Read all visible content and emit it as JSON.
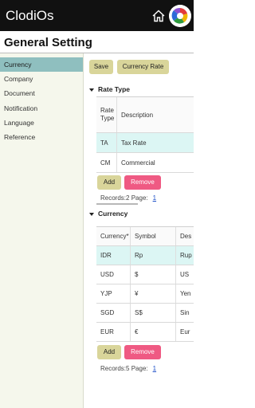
{
  "app": {
    "title": "ClodiOs"
  },
  "icons": {
    "home": "home-icon",
    "avatar": "avatar-icon"
  },
  "page": {
    "title": "General Setting"
  },
  "sidebar": {
    "items": [
      {
        "label": "Currency",
        "active": true
      },
      {
        "label": "Company"
      },
      {
        "label": "Document"
      },
      {
        "label": "Notification"
      },
      {
        "label": "Language"
      },
      {
        "label": "Reference"
      }
    ]
  },
  "toolbar": {
    "save_label": "Save",
    "currency_rate_label": "Currency Rate"
  },
  "rate_type": {
    "title": "Rate Type",
    "columns": [
      "Rate Type",
      "Description"
    ],
    "rows": [
      {
        "code": "TA",
        "description": "Tax Rate",
        "selected": true
      },
      {
        "code": "CM",
        "description": "Commercial"
      }
    ],
    "add_label": "Add",
    "remove_label": "Remove",
    "records_label": "Records:2",
    "page_label": "Page:",
    "page_number": "1"
  },
  "currency": {
    "title": "Currency",
    "columns": [
      "Currency*",
      "Symbol",
      "Des"
    ],
    "rows": [
      {
        "code": "IDR",
        "symbol": "Rp",
        "description": "Rup",
        "selected": true
      },
      {
        "code": "USD",
        "symbol": "$",
        "description": "US"
      },
      {
        "code": "YJP",
        "symbol": "¥",
        "description": "Yen"
      },
      {
        "code": "SGD",
        "symbol": "S$",
        "description": "Sin"
      },
      {
        "code": "EUR",
        "symbol": "€",
        "description": "Eur"
      }
    ],
    "add_label": "Add",
    "remove_label": "Remove",
    "records_label": "Records:5",
    "page_label": "Page:",
    "page_number": "1"
  },
  "colors": {
    "topbar": "#111111",
    "sidebar_active": "#8fbfbf",
    "button_primary": "#d9d59a",
    "button_remove": "#ef5a83",
    "row_selected": "#dcf6f4",
    "link": "#1e50c8"
  }
}
